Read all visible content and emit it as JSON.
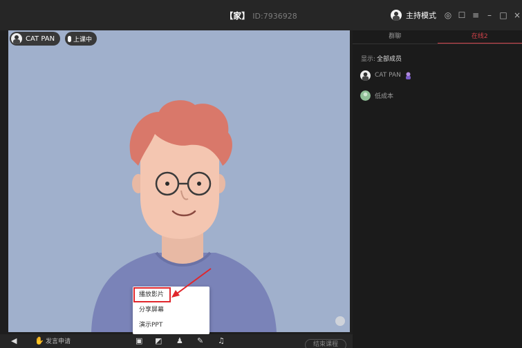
{
  "window": {
    "room_name": "【家】",
    "room_id": "ID:7936928",
    "mode_label": "主持模式",
    "controls": [
      "settings-icon",
      "popout-icon",
      "menu-icon",
      "minimize-icon",
      "maximize-icon",
      "close-icon"
    ]
  },
  "video": {
    "host_name": "CAT PAN",
    "status_label": "上课中"
  },
  "share_menu": {
    "items": [
      "播放影片",
      "分享屏幕",
      "演示PPT"
    ],
    "highlighted_item": "播放影片"
  },
  "bottom_bar": {
    "apply_speak_label": "发言申请",
    "end_label": "结束课程"
  },
  "side_panel": {
    "tabs": [
      "群聊",
      "在线2"
    ],
    "active_tab": "在线2",
    "filter_label": "显示:",
    "filter_value": "全部成员",
    "members": [
      {
        "name": "CAT PAN",
        "role_icon": "teacher-badge-icon"
      },
      {
        "name": "低成本",
        "role_icon": ""
      }
    ]
  },
  "colors": {
    "accent": "#d2424a",
    "highlight_box": "#e0262c",
    "video_bg": "#a0b0cc"
  }
}
